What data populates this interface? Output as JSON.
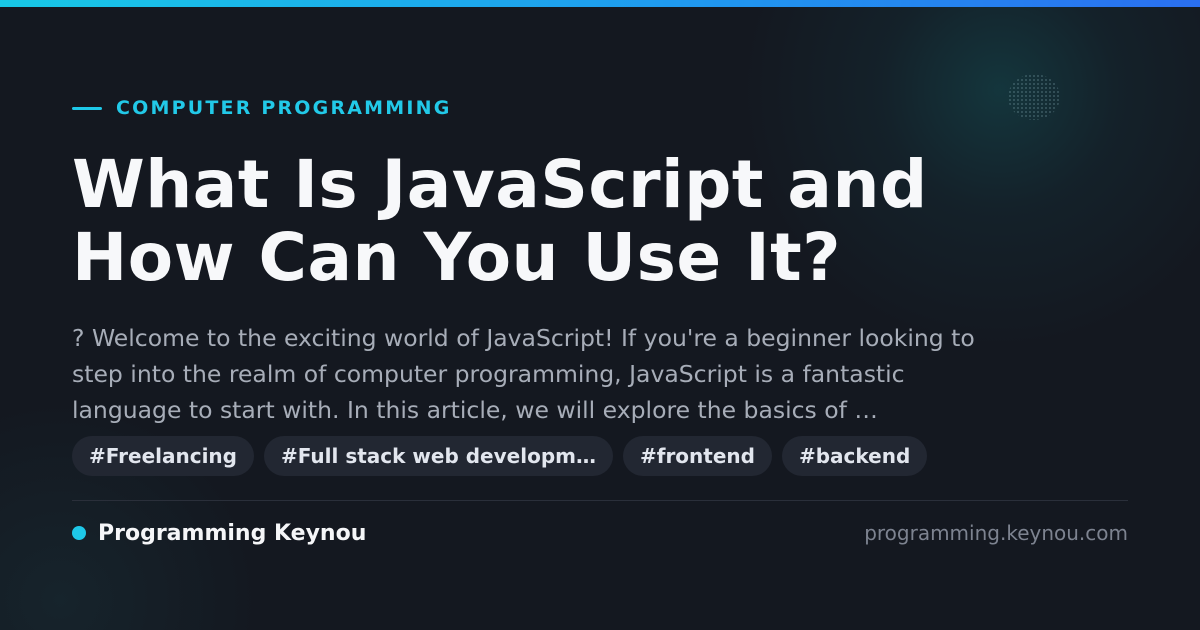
{
  "category": "COMPUTER PROGRAMMING",
  "title": {
    "line1": "What Is JavaScript and",
    "line2": "How Can You Use It?"
  },
  "excerpt": {
    "line1": "? Welcome to the exciting world of JavaScript! If you're a beginner looking to",
    "line2": "step into the realm of computer programming, JavaScript is a fantastic",
    "line3": "language to start with. In this article, we will explore the basics of …"
  },
  "tags": [
    "#Freelancing",
    "#Full stack web developm…",
    "#frontend",
    "#backend"
  ],
  "footer": {
    "brand": "Programming Keynou",
    "domain": "programming.keynou.com"
  },
  "colors": {
    "accent": "#1ec8e8",
    "background": "#141820",
    "tag_background": "#222732",
    "title": "#f7f8fa",
    "excerpt": "#a7adb8",
    "domain": "#7d8390"
  }
}
